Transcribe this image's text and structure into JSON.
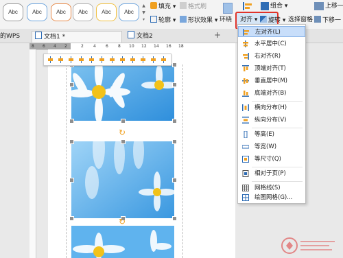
{
  "ribbon": {
    "style_samples": [
      "Abc",
      "Abc",
      "Abc",
      "Abc",
      "Abc",
      "Abc"
    ],
    "fill": "填充",
    "format_painter": "格式刷",
    "outline": "轮廓",
    "shape_effects": "形状效果",
    "wrap": "环绕",
    "align": "对齐",
    "rotate": "旋转",
    "selection_pane": "选择窗格",
    "group": "组合",
    "bring_forward": "上移一",
    "send_backward": "下移一"
  },
  "tabs": [
    {
      "label": "的WPS"
    },
    {
      "label": "文档1 *"
    },
    {
      "label": "文档2"
    }
  ],
  "ruler_marks": [
    "8",
    "6",
    "4",
    "2",
    "2",
    "4",
    "6",
    "8",
    "10",
    "12",
    "14",
    "16",
    "18"
  ],
  "align_menu": {
    "items": [
      {
        "label": "左对齐(L)",
        "icon": "align-left-icon",
        "selected": true
      },
      {
        "label": "水平居中(C)",
        "icon": "align-center-icon"
      },
      {
        "label": "右对齐(R)",
        "icon": "align-right-icon"
      },
      {
        "label": "顶端对齐(T)",
        "icon": "align-top-icon"
      },
      {
        "label": "垂直居中(M)",
        "icon": "align-middle-icon"
      },
      {
        "label": "底端对齐(B)",
        "icon": "align-bottom-icon"
      },
      {
        "label": "横向分布(H)",
        "icon": "distribute-horizontal-icon"
      },
      {
        "label": "纵向分布(V)",
        "icon": "distribute-vertical-icon"
      },
      {
        "label": "等高(E)",
        "icon": "same-height-icon"
      },
      {
        "label": "等宽(W)",
        "icon": "same-width-icon"
      },
      {
        "label": "等尺寸(Q)",
        "icon": "same-size-icon"
      },
      {
        "label": "相对于页(P)",
        "icon": "relative-to-page-icon"
      },
      {
        "label": "网格线(S)",
        "icon": "gridlines-icon"
      },
      {
        "label": "绘图网格(G)...",
        "icon": "drawing-grid-icon"
      }
    ]
  },
  "colors": {
    "highlight": "#e0332a",
    "accent_blue": "#2f6db5",
    "accent_orange": "#f0a020"
  }
}
